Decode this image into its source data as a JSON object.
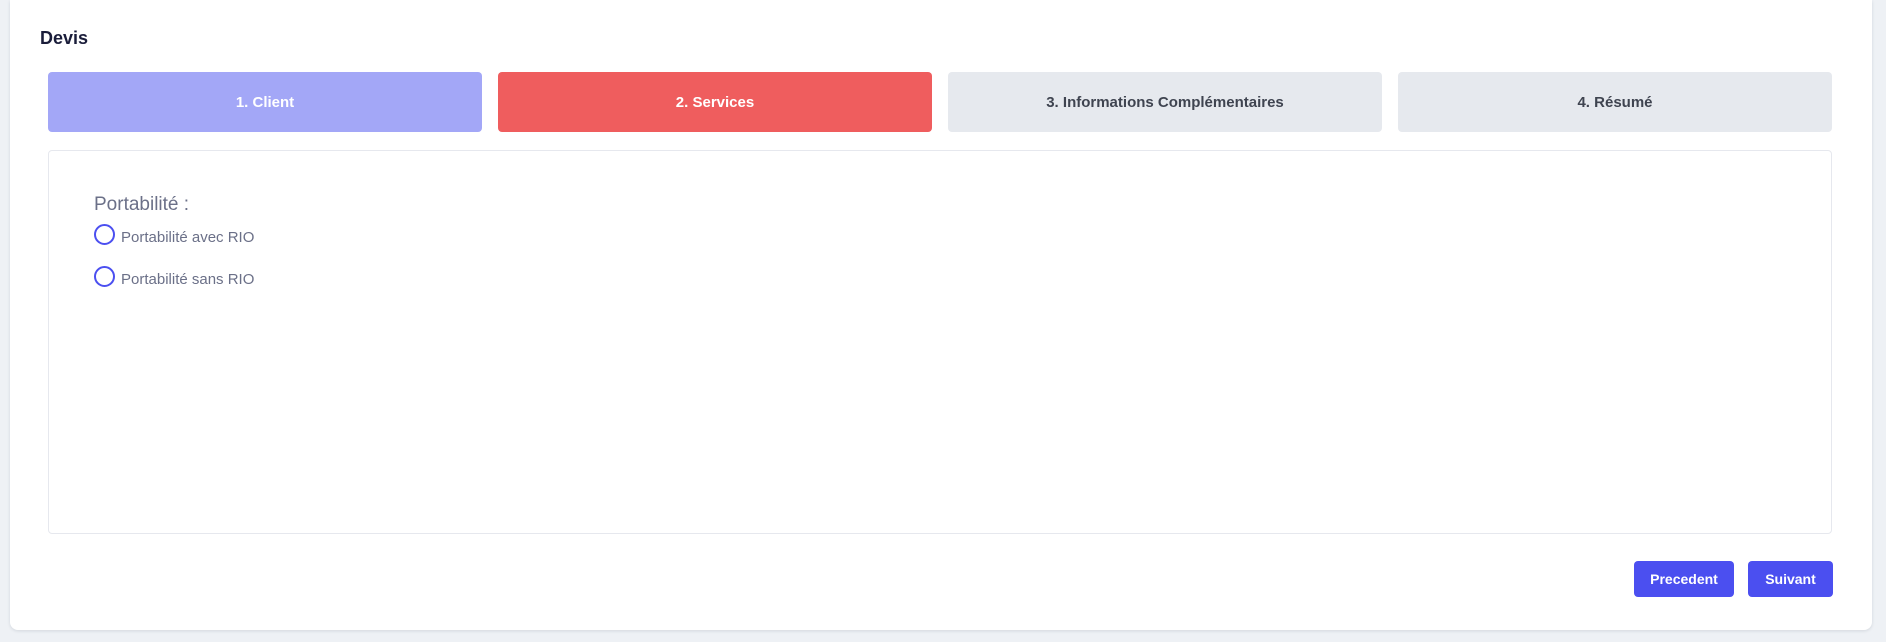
{
  "card": {
    "title": "Devis"
  },
  "steps": [
    {
      "label": "1. Client",
      "state": "completed",
      "bg": "#a3a7f7",
      "fg": "#ffffff"
    },
    {
      "label": "2. Services",
      "state": "active",
      "bg": "#ef5d5e",
      "fg": "#ffffff"
    },
    {
      "label": "3. Informations Complémentaires",
      "state": "pending",
      "bg": "#e6e9ee",
      "fg": "#3f4450"
    },
    {
      "label": "4. Résumé",
      "state": "pending",
      "bg": "#e6e9ee",
      "fg": "#3f4450"
    }
  ],
  "portability": {
    "label": "Portabilité :",
    "options": [
      {
        "label": "Portabilité avec RIO",
        "checked": false
      },
      {
        "label": "Portabilité sans RIO",
        "checked": false
      }
    ]
  },
  "actions": {
    "previous_label": "Precedent",
    "next_label": "Suivant"
  },
  "colors": {
    "accent": "#4b4ff0",
    "page_background": "#eef1f5"
  }
}
